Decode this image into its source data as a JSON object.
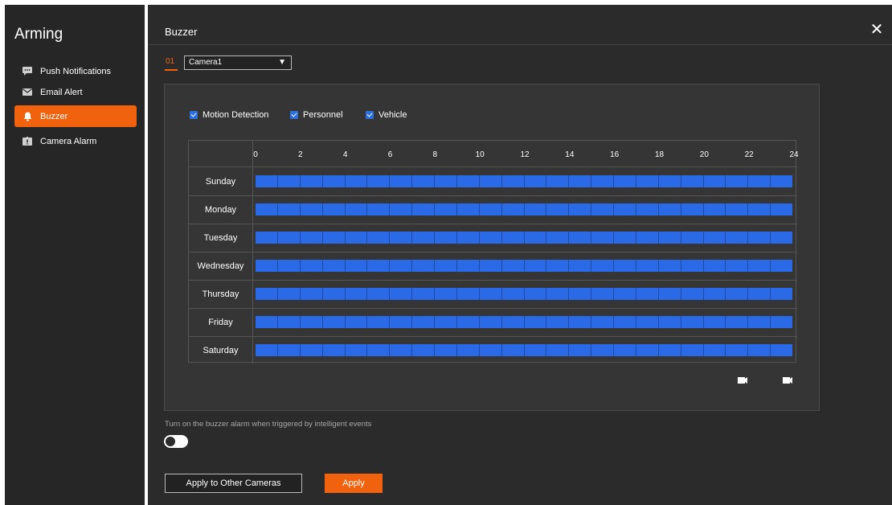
{
  "sidebar": {
    "title": "Arming",
    "items": [
      {
        "label": "Push Notifications",
        "icon": "chat-icon"
      },
      {
        "label": "Email Alert",
        "icon": "mail-icon"
      },
      {
        "label": "Buzzer",
        "icon": "bell-icon",
        "active": true
      },
      {
        "label": "Camera Alarm",
        "icon": "camera-alarm-icon"
      }
    ]
  },
  "header": {
    "title": "Buzzer",
    "close_icon": "close-icon"
  },
  "camera": {
    "index": "01",
    "selected": "Camera1"
  },
  "detection": {
    "motion_label": "Motion Detection",
    "personnel_label": "Personnel",
    "vehicle_label": "Vehicle",
    "motion_checked": true,
    "personnel_checked": true,
    "vehicle_checked": true
  },
  "schedule": {
    "hours": [
      "0",
      "2",
      "4",
      "6",
      "8",
      "10",
      "12",
      "14",
      "16",
      "18",
      "20",
      "22",
      "24"
    ],
    "days": [
      "Sunday",
      "Monday",
      "Tuesday",
      "Wednesday",
      "Thursday",
      "Friday",
      "Saturday"
    ],
    "active_hours_per_day": 24
  },
  "hint": "Turn on the buzzer alarm when  triggered by intelligent events",
  "toggle_on": false,
  "buttons": {
    "apply_other": "Apply to Other Cameras",
    "apply": "Apply"
  },
  "colors": {
    "accent": "#f0620e",
    "schedule_blue": "#2a6ae6"
  }
}
